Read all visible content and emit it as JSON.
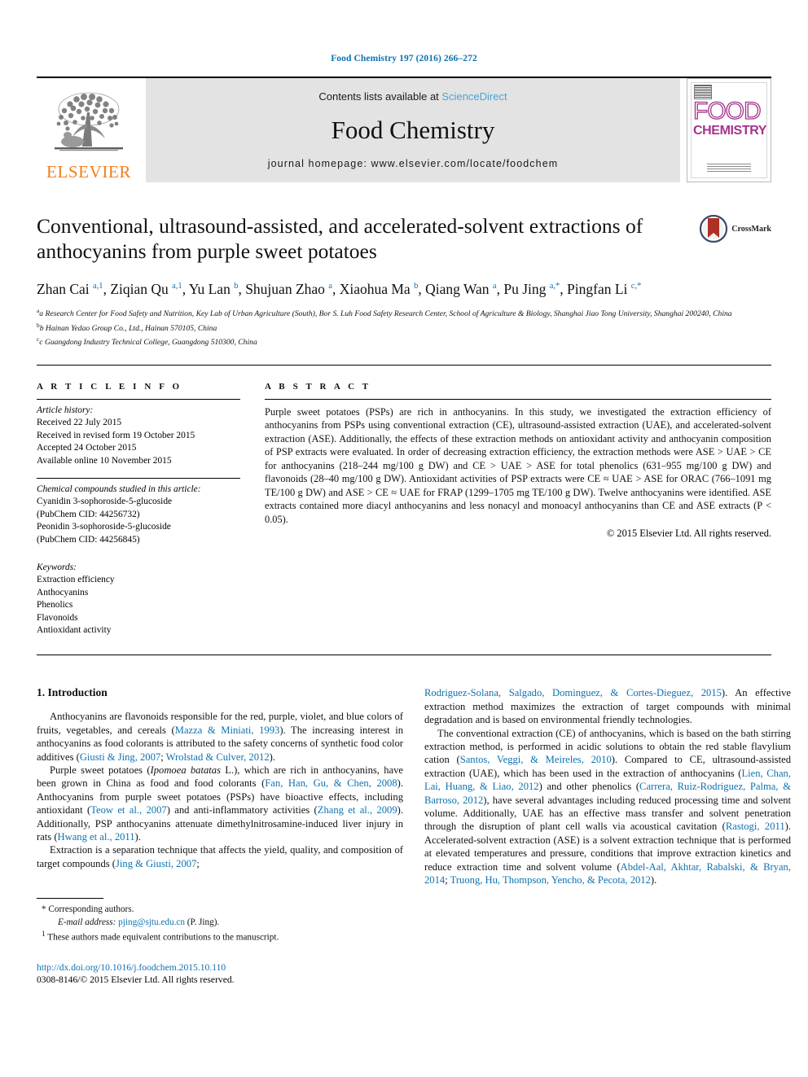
{
  "running_head": "Food Chemistry 197 (2016) 266–272",
  "masthead": {
    "publisher_name": "ELSEVIER",
    "contents_prefix": "Contents lists available at ",
    "contents_link": "ScienceDirect",
    "journal_title": "Food Chemistry",
    "homepage": "journal homepage: www.elsevier.com/locate/foodchem",
    "cover_food": "FOOD",
    "cover_chemistry": "CHEMISTRY"
  },
  "article": {
    "title": "Conventional, ultrasound-assisted, and accelerated-solvent extractions of anthocyanins from purple sweet potatoes",
    "crossmark_label": "CrossMark",
    "authors_html": "Zhan Cai <sup>a,1</sup>, Ziqian Qu <sup>a,1</sup>, Yu Lan <sup>b</sup>, Shujuan Zhao <sup>a</sup>, Xiaohua Ma <sup>b</sup>, Qiang Wan <sup>a</sup>, Pu Jing <sup>a,</sup><sup>*</sup>, Pingfan Li <sup>c,</sup><sup>*</sup>",
    "affiliations": [
      "a Research Center for Food Safety and Nutrition, Key Lab of Urban Agriculture (South), Bor S. Luh Food Safety Research Center, School of Agriculture & Biology, Shanghai Jiao Tong University, Shanghai 200240, China",
      "b Hainan Yedao Group Co., Ltd., Hainan 570105, China",
      "c Guangdong Industry Technical College, Guangdong 510300, China"
    ]
  },
  "article_info": {
    "heading": "A R T I C L E  I N F O",
    "history_label": "Article history:",
    "history": [
      "Received 22 July 2015",
      "Received in revised form 19 October 2015",
      "Accepted 24 October 2015",
      "Available online 10 November 2015"
    ],
    "compounds_label": "Chemical compounds studied in this article:",
    "compounds": [
      "Cyanidin 3-sophoroside-5-glucoside",
      "(PubChem CID: 44256732)",
      "Peonidin 3-sophoroside-5-glucoside",
      "(PubChem CID: 44256845)"
    ],
    "keywords_label": "Keywords:",
    "keywords": [
      "Extraction efficiency",
      "Anthocyanins",
      "Phenolics",
      "Flavonoids",
      "Antioxidant activity"
    ]
  },
  "abstract": {
    "heading": "A B S T R A C T",
    "text": "Purple sweet potatoes (PSPs) are rich in anthocyanins. In this study, we investigated the extraction efficiency of anthocyanins from PSPs using conventional extraction (CE), ultrasound-assisted extraction (UAE), and accelerated-solvent extraction (ASE). Additionally, the effects of these extraction methods on antioxidant activity and anthocyanin composition of PSP extracts were evaluated. In order of decreasing extraction efficiency, the extraction methods were ASE > UAE > CE for anthocyanins (218–244 mg/100 g DW) and CE > UAE > ASE for total phenolics (631–955 mg/100 g DW) and flavonoids (28–40 mg/100 g DW). Antioxidant activities of PSP extracts were CE ≈ UAE > ASE for ORAC (766–1091 mg TE/100 g DW) and ASE > CE ≈ UAE for FRAP (1299–1705 mg TE/100 g DW). Twelve anthocyanins were identified. ASE extracts contained more diacyl anthocyanins and less nonacyl and monoacyl anthocyanins than CE and ASE extracts (P < 0.05).",
    "copyright": "© 2015 Elsevier Ltd. All rights reserved."
  },
  "introduction": {
    "heading": "1. Introduction",
    "left_paragraphs": [
      "Anthocyanins are flavonoids responsible for the red, purple, violet, and blue colors of fruits, vegetables, and cereals (Mazza & Miniati, 1993). The increasing interest in anthocyanins as food colorants is attributed to the safety concerns of synthetic food color additives (Giusti & Jing, 2007; Wrolstad & Culver, 2012).",
      "Purple sweet potatoes (Ipomoea batatas L.), which are rich in anthocyanins, have been grown in China as food and food colorants (Fan, Han, Gu, & Chen, 2008). Anthocyanins from purple sweet potatoes (PSPs) have bioactive effects, including antioxidant (Teow et al., 2007) and anti-inflammatory activities (Zhang et al., 2009). Additionally, PSP anthocyanins attenuate dimethylnitrosamine-induced liver injury in rats (Hwang et al., 2011).",
      "Extraction is a separation technique that affects the yield, quality, and composition of target compounds (Jing & Giusti, 2007;"
    ],
    "right_paragraphs": [
      "Rodriguez-Solana, Salgado, Dominguez, & Cortes-Dieguez, 2015). An effective extraction method maximizes the extraction of target compounds with minimal degradation and is based on environmental friendly technologies.",
      "The conventional extraction (CE) of anthocyanins, which is based on the bath stirring extraction method, is performed in acidic solutions to obtain the red stable flavylium cation (Santos, Veggi, & Meireles, 2010). Compared to CE, ultrasound-assisted extraction (UAE), which has been used in the extraction of anthocyanins (Lien, Chan, Lai, Huang, & Liao, 2012) and other phenolics (Carrera, Ruiz-Rodriguez, Palma, & Barroso, 2012), have several advantages including reduced processing time and solvent volume. Additionally, UAE has an effective mass transfer and solvent penetration through the disruption of plant cell walls via acoustical cavitation (Rastogi, 2011). Accelerated-solvent extraction (ASE) is a solvent extraction technique that is performed at elevated temperatures and pressure, conditions that improve extraction kinetics and reduce extraction time and solvent volume (Abdel-Aal, Akhtar, Rabalski, & Bryan, 2014; Truong, Hu, Thompson, Yencho, & Pecota, 2012)."
    ]
  },
  "footnotes": {
    "corresponding": "Corresponding authors.",
    "email_label": "E-mail address:",
    "email": "pjing@sjtu.edu.cn",
    "email_suffix": "(P. Jing).",
    "equal_contrib": "These authors made equivalent contributions to the manuscript."
  },
  "footer": {
    "doi": "http://dx.doi.org/10.1016/j.foodchem.2015.10.110",
    "issn_line": "0308-8146/© 2015 Elsevier Ltd. All rights reserved."
  },
  "colors": {
    "link_blue": "#0d72b0",
    "sciencedirect_blue": "#4ba3d8",
    "elsevier_orange": "#f07f1a",
    "banner_grey": "#e3e3e3",
    "cover_magenta": "#a4338e",
    "crossmark_red": "#b03024"
  }
}
